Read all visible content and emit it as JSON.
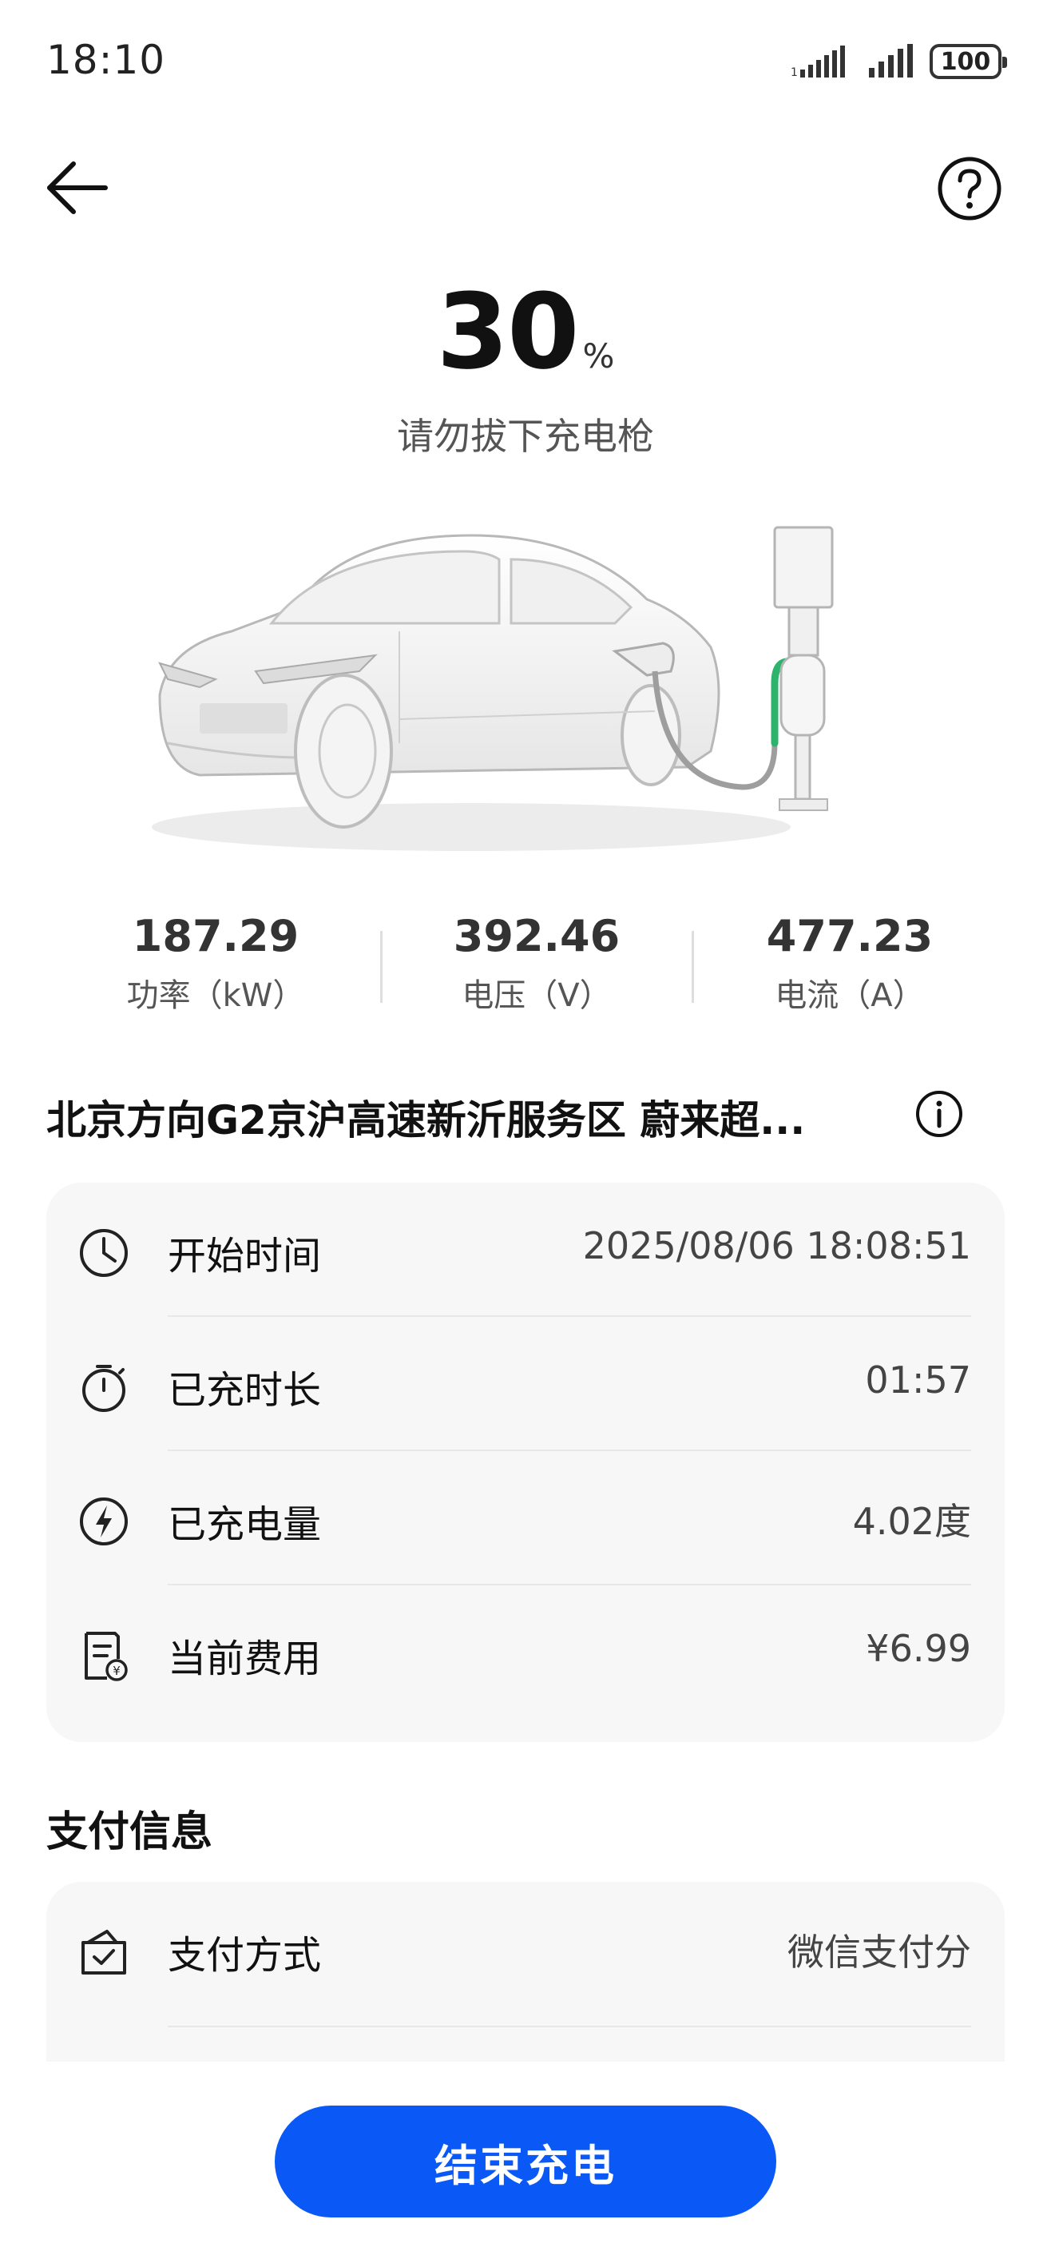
{
  "status_bar": {
    "time": "18:10",
    "battery": "100"
  },
  "nav": {
    "back_icon": "back-arrow-icon",
    "help_icon": "question-circle-icon"
  },
  "charging": {
    "percent": "30",
    "percent_unit": "%",
    "hint": "请勿拔下充电枪"
  },
  "stats": [
    {
      "value": "187.29",
      "label": "功率（kW）"
    },
    {
      "value": "392.46",
      "label": "电压（V）"
    },
    {
      "value": "477.23",
      "label": "电流（A）"
    }
  ],
  "station": {
    "name": "北京方向G2京沪高速新沂服务区 蔚来超...",
    "info_icon": "info-circle-icon"
  },
  "session": {
    "rows": [
      {
        "icon": "clock-icon",
        "label": "开始时间",
        "value": "2025/08/06 18:08:51"
      },
      {
        "icon": "stopwatch-icon",
        "label": "已充时长",
        "value": "01:57"
      },
      {
        "icon": "lightning-icon",
        "label": "已充电量",
        "value": "4.02度"
      },
      {
        "icon": "bill-icon",
        "label": "当前费用",
        "value": "¥6.99"
      }
    ]
  },
  "payment": {
    "section_title": "支付信息",
    "rows": [
      {
        "icon": "wallet-check-icon",
        "label": "支付方式",
        "value": "微信支付分"
      }
    ]
  },
  "actions": {
    "end_charging": "结束充电"
  },
  "colors": {
    "primary": "#0a59f7",
    "charging_green": "#2db36b",
    "card_bg": "#f7f7f7"
  }
}
